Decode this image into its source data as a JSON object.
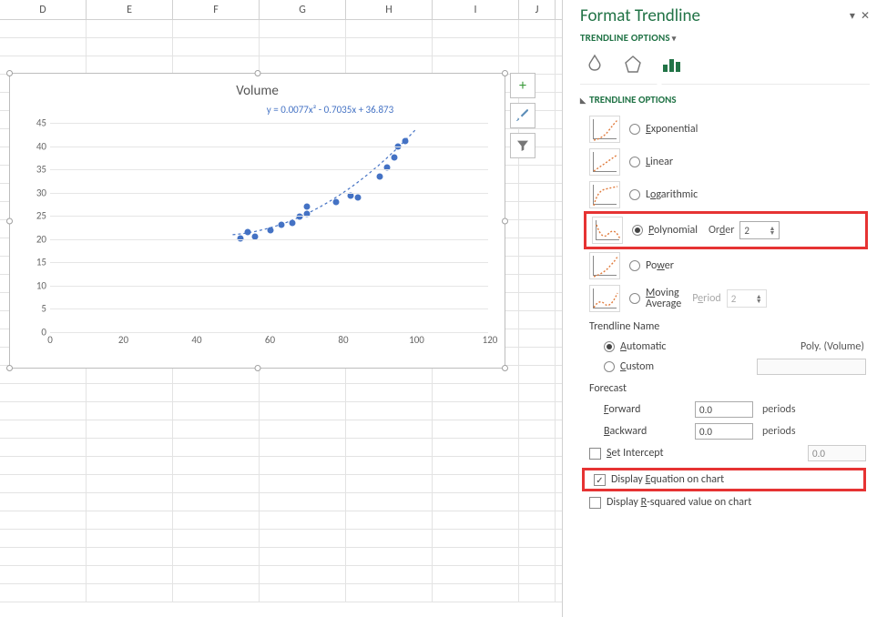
{
  "columns": [
    "D",
    "E",
    "F",
    "G",
    "H",
    "I",
    "J"
  ],
  "chart_data": {
    "type": "scatter",
    "title": "Volume",
    "equation": "y = 0.0077x² - 0.7035x + 36.873",
    "xlabel": "",
    "ylabel": "",
    "xlim": [
      0,
      120
    ],
    "ylim": [
      0,
      45
    ],
    "x_ticks": [
      0,
      20,
      40,
      60,
      80,
      100,
      120
    ],
    "y_ticks": [
      0,
      5,
      10,
      15,
      20,
      25,
      30,
      35,
      40,
      45
    ],
    "x": [
      52,
      54,
      56,
      60,
      63,
      66,
      68,
      70,
      70,
      78,
      82,
      84,
      90,
      92,
      94,
      95,
      97
    ],
    "y": [
      20.2,
      21.5,
      20.5,
      22.0,
      23.0,
      23.5,
      24.8,
      27.0,
      25.5,
      28.0,
      29.3,
      29.0,
      33.5,
      35.5,
      37.5,
      40.0,
      41.0
    ],
    "trendline": {
      "type": "polynomial",
      "order": 2,
      "coeffs": [
        0.0077,
        -0.7035,
        36.873
      ]
    }
  },
  "chart_buttons": {
    "plus": "+",
    "brush": "brush-icon",
    "filter": "funnel-icon"
  },
  "panel": {
    "title": "Format Trendline",
    "subtitle": "TRENDLINE OPTIONS",
    "section": "TRENDLINE OPTIONS",
    "options": {
      "exponential": "Exponential",
      "linear": "Linear",
      "logarithmic": "Logarithmic",
      "polynomial": "Polynomial",
      "poly_order_label": "Order",
      "poly_order_value": "2",
      "power": "Power",
      "moving_avg": "Moving Average",
      "moving_period_label": "Period",
      "moving_period_value": "2"
    },
    "trendline_name": {
      "head": "Trendline Name",
      "automatic": "Automatic",
      "auto_value": "Poly. (Volume)",
      "custom": "Custom"
    },
    "forecast": {
      "head": "Forecast",
      "forward_label": "Forward",
      "forward_value": "0.0",
      "backward_label": "Backward",
      "backward_value": "0.0",
      "unit": "periods"
    },
    "intercept": {
      "label": "Set Intercept",
      "value": "0.0"
    },
    "display_eq": "Display Equation on chart",
    "display_r2": "Display R-squared value on chart"
  }
}
